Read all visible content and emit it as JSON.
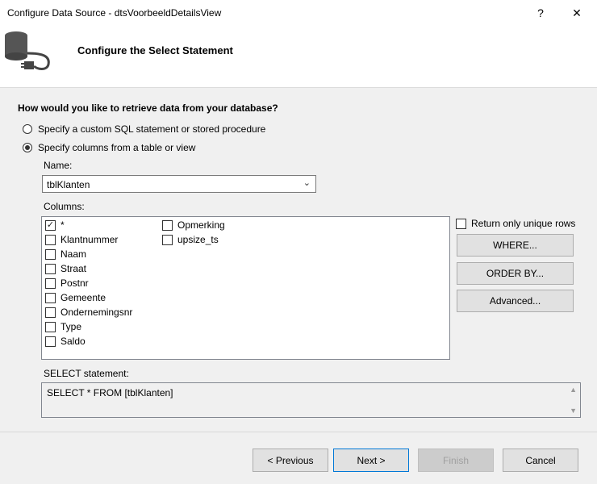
{
  "window": {
    "title": "Configure Data Source - dtsVoorbeeldDetailsView",
    "help": "?",
    "close": "✕"
  },
  "header": {
    "title": "Configure the Select Statement",
    "icon": "database-plug-icon"
  },
  "question": "How would you like to retrieve data from your database?",
  "options": [
    {
      "label": "Specify a custom SQL statement or stored procedure",
      "selected": false
    },
    {
      "label": "Specify columns from a table or view",
      "selected": true
    }
  ],
  "name_label": "Name:",
  "table_select": {
    "value": "tblKlanten"
  },
  "columns_label": "Columns:",
  "columns": [
    {
      "label": "*",
      "checked": true
    },
    {
      "label": "Klantnummer",
      "checked": false
    },
    {
      "label": "Naam",
      "checked": false
    },
    {
      "label": "Straat",
      "checked": false
    },
    {
      "label": "Postnr",
      "checked": false
    },
    {
      "label": "Gemeente",
      "checked": false
    },
    {
      "label": "Ondernemingsnr",
      "checked": false
    },
    {
      "label": "Type",
      "checked": false
    },
    {
      "label": "Saldo",
      "checked": false
    },
    {
      "label": "Opmerking",
      "checked": false
    },
    {
      "label": "upsize_ts",
      "checked": false
    }
  ],
  "unique_rows": {
    "label": "Return only unique rows",
    "checked": false
  },
  "side_buttons": {
    "where": "WHERE...",
    "order_by": "ORDER BY...",
    "advanced": "Advanced..."
  },
  "select_statement": {
    "label": "SELECT statement:",
    "value": "SELECT * FROM [tblKlanten]"
  },
  "footer": {
    "previous": "< Previous",
    "next": "Next >",
    "finish": "Finish",
    "cancel": "Cancel"
  }
}
